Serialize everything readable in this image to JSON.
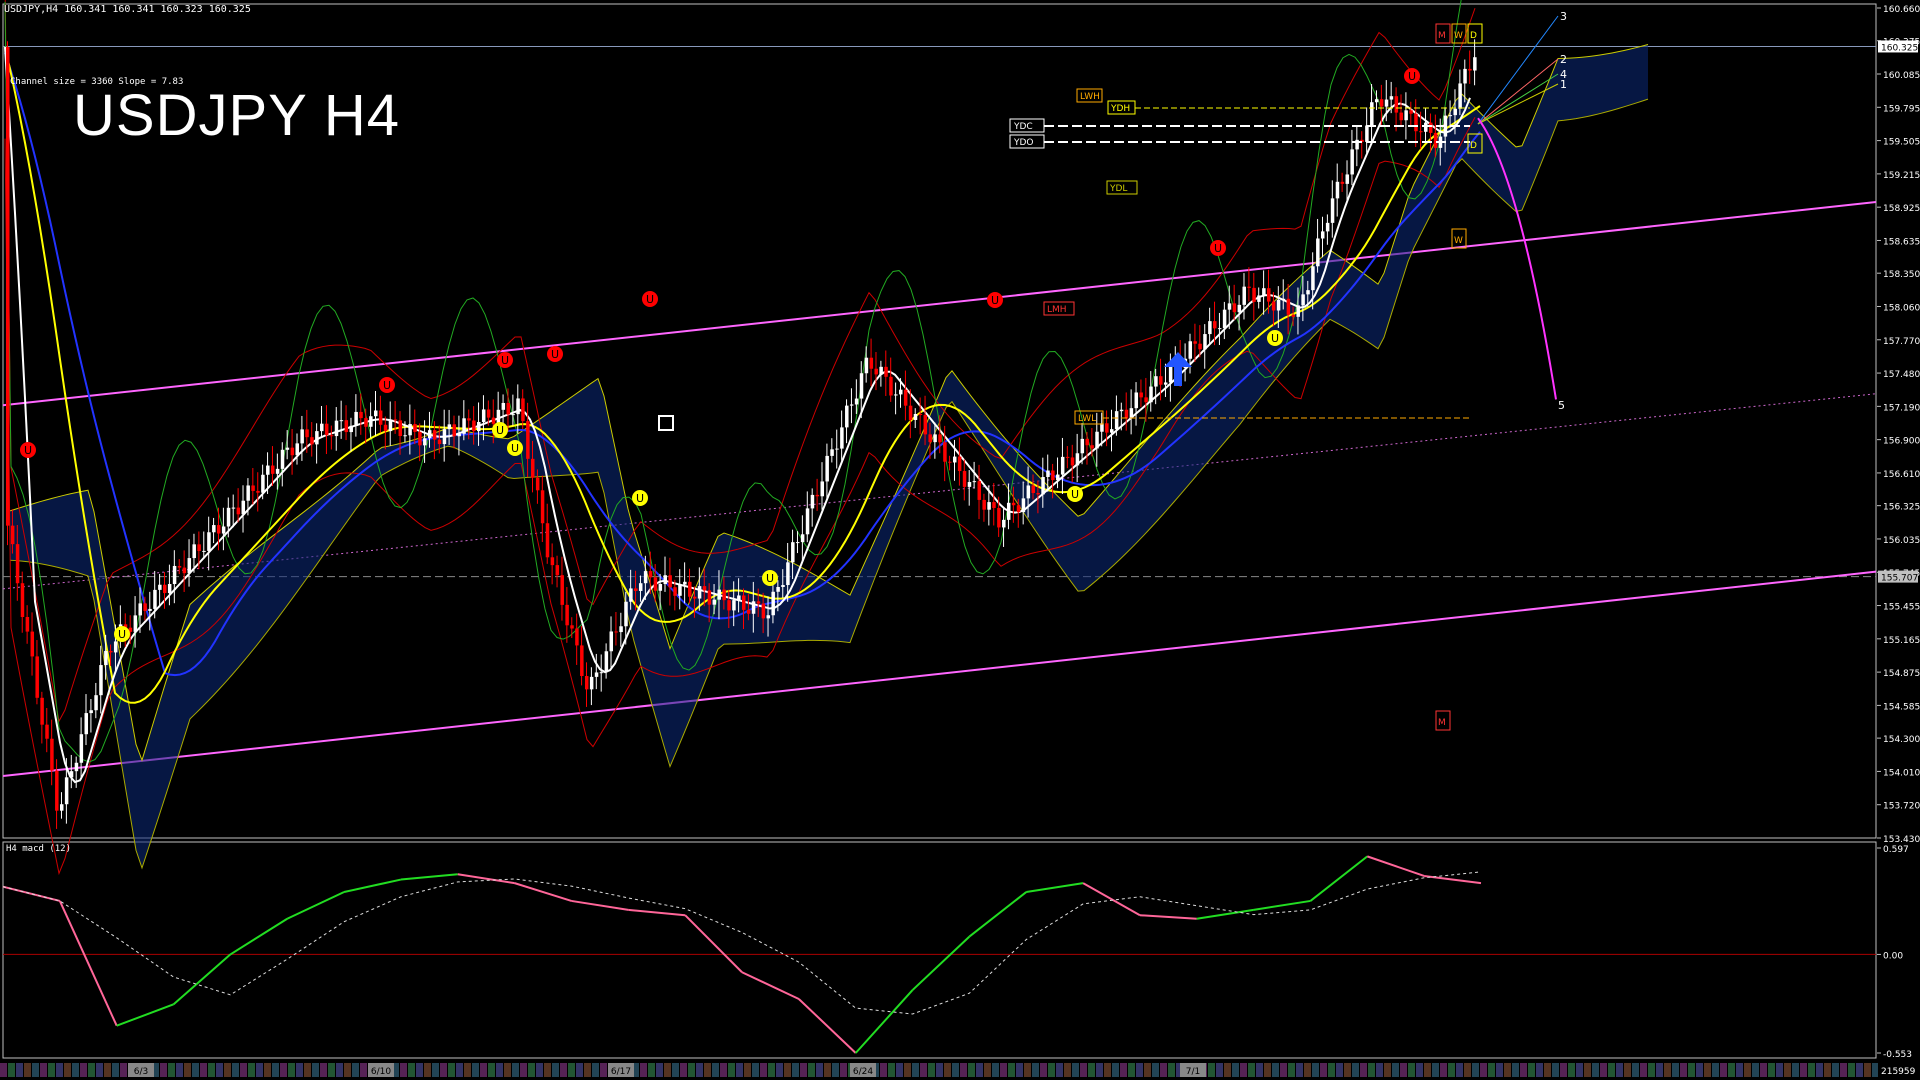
{
  "header": {
    "symbol_line": "USDJPY,H4  160.341 160.341 160.323 160.325",
    "channel_info": "Channel size = 3360 Slope = 7.83",
    "big_title": "USDJPY H4",
    "macd_title": "H4  macd (12)"
  },
  "price_axis": {
    "labels": [
      "160.660",
      "160.375",
      "160.085",
      "159.795",
      "159.505",
      "159.215",
      "158.925",
      "158.635",
      "158.350",
      "158.060",
      "157.770",
      "157.480",
      "157.190",
      "156.900",
      "156.610",
      "156.325",
      "156.035",
      "155.745",
      "155.455",
      "155.165",
      "154.875",
      "154.585",
      "154.300",
      "154.010",
      "153.720",
      "153.430"
    ],
    "current_price_tag": "160.325",
    "hline_tag": "155.707"
  },
  "macd_axis": {
    "labels": [
      "0.597",
      "0.00",
      "-0.553"
    ],
    "bottom_tag": "215959"
  },
  "time_axis": {
    "labels": [
      "6/3",
      "6/10",
      "6/17",
      "6/24",
      "7/1"
    ]
  },
  "overlay_labels": {
    "LWH": "LWH",
    "YDH": "YDH",
    "YDC": "YDC",
    "YDO": "YDO",
    "YDL": "YDL",
    "LMH": "LMH",
    "LWL": "LWL",
    "M_top": "M",
    "W_top": "W",
    "D_top": "D",
    "D_mid": "D",
    "W_mid": "W",
    "M_low": "M",
    "proj": [
      "3",
      "2",
      "4",
      "1",
      "5"
    ]
  },
  "chart_data": {
    "type": "candlestick",
    "title": "USDJPY H4",
    "timeframe": "H4",
    "ylim": [
      153.43,
      160.66
    ],
    "x_dates": [
      "6/3",
      "6/10",
      "6/17",
      "6/24",
      "7/1"
    ],
    "ohlc_last": {
      "open": 160.341,
      "high": 160.341,
      "low": 160.323,
      "close": 160.325
    },
    "key_points": [
      {
        "date": "5/31",
        "price": 156.2
      },
      {
        "date": "6/3",
        "price": 153.65
      },
      {
        "date": "6/4",
        "price": 155.1
      },
      {
        "date": "6/7",
        "price": 156.9
      },
      {
        "date": "6/10",
        "price": 157.1
      },
      {
        "date": "6/12",
        "price": 156.9
      },
      {
        "date": "6/14",
        "price": 157.2
      },
      {
        "date": "6/14",
        "price": 155.9
      },
      {
        "date": "6/17",
        "price": 154.7
      },
      {
        "date": "6/18",
        "price": 155.7
      },
      {
        "date": "6/20",
        "price": 155.4
      },
      {
        "date": "6/24",
        "price": 157.6
      },
      {
        "date": "6/25",
        "price": 156.2
      },
      {
        "date": "6/27",
        "price": 157.4
      },
      {
        "date": "6/28",
        "price": 158.2
      },
      {
        "date": "7/1",
        "price": 158.0
      },
      {
        "date": "7/2",
        "price": 158.9
      },
      {
        "date": "7/3",
        "price": 159.9
      },
      {
        "date": "7/4",
        "price": 159.5
      },
      {
        "date": "7/5",
        "price": 160.32
      }
    ],
    "macd": {
      "title": "H4 macd (12)",
      "ylim": [
        -0.553,
        0.597
      ],
      "values": [
        0.38,
        0.3,
        -0.4,
        -0.28,
        0.0,
        0.2,
        0.35,
        0.42,
        0.45,
        0.4,
        0.3,
        0.25,
        0.22,
        -0.1,
        -0.25,
        -0.553,
        -0.2,
        0.1,
        0.35,
        0.4,
        0.22,
        0.2,
        0.25,
        0.3,
        0.55,
        0.44,
        0.4
      ]
    },
    "colors": {
      "up": "#ffffff",
      "down": "#ff0000",
      "channel": "#ff66ff",
      "ma_fast": "#ffffff",
      "ma_mid": "#ffff00",
      "ma_slow": "#0000ff",
      "macd_up": "#00ff00",
      "macd_down": "#ff6699",
      "cloud": "#1133aa"
    }
  }
}
